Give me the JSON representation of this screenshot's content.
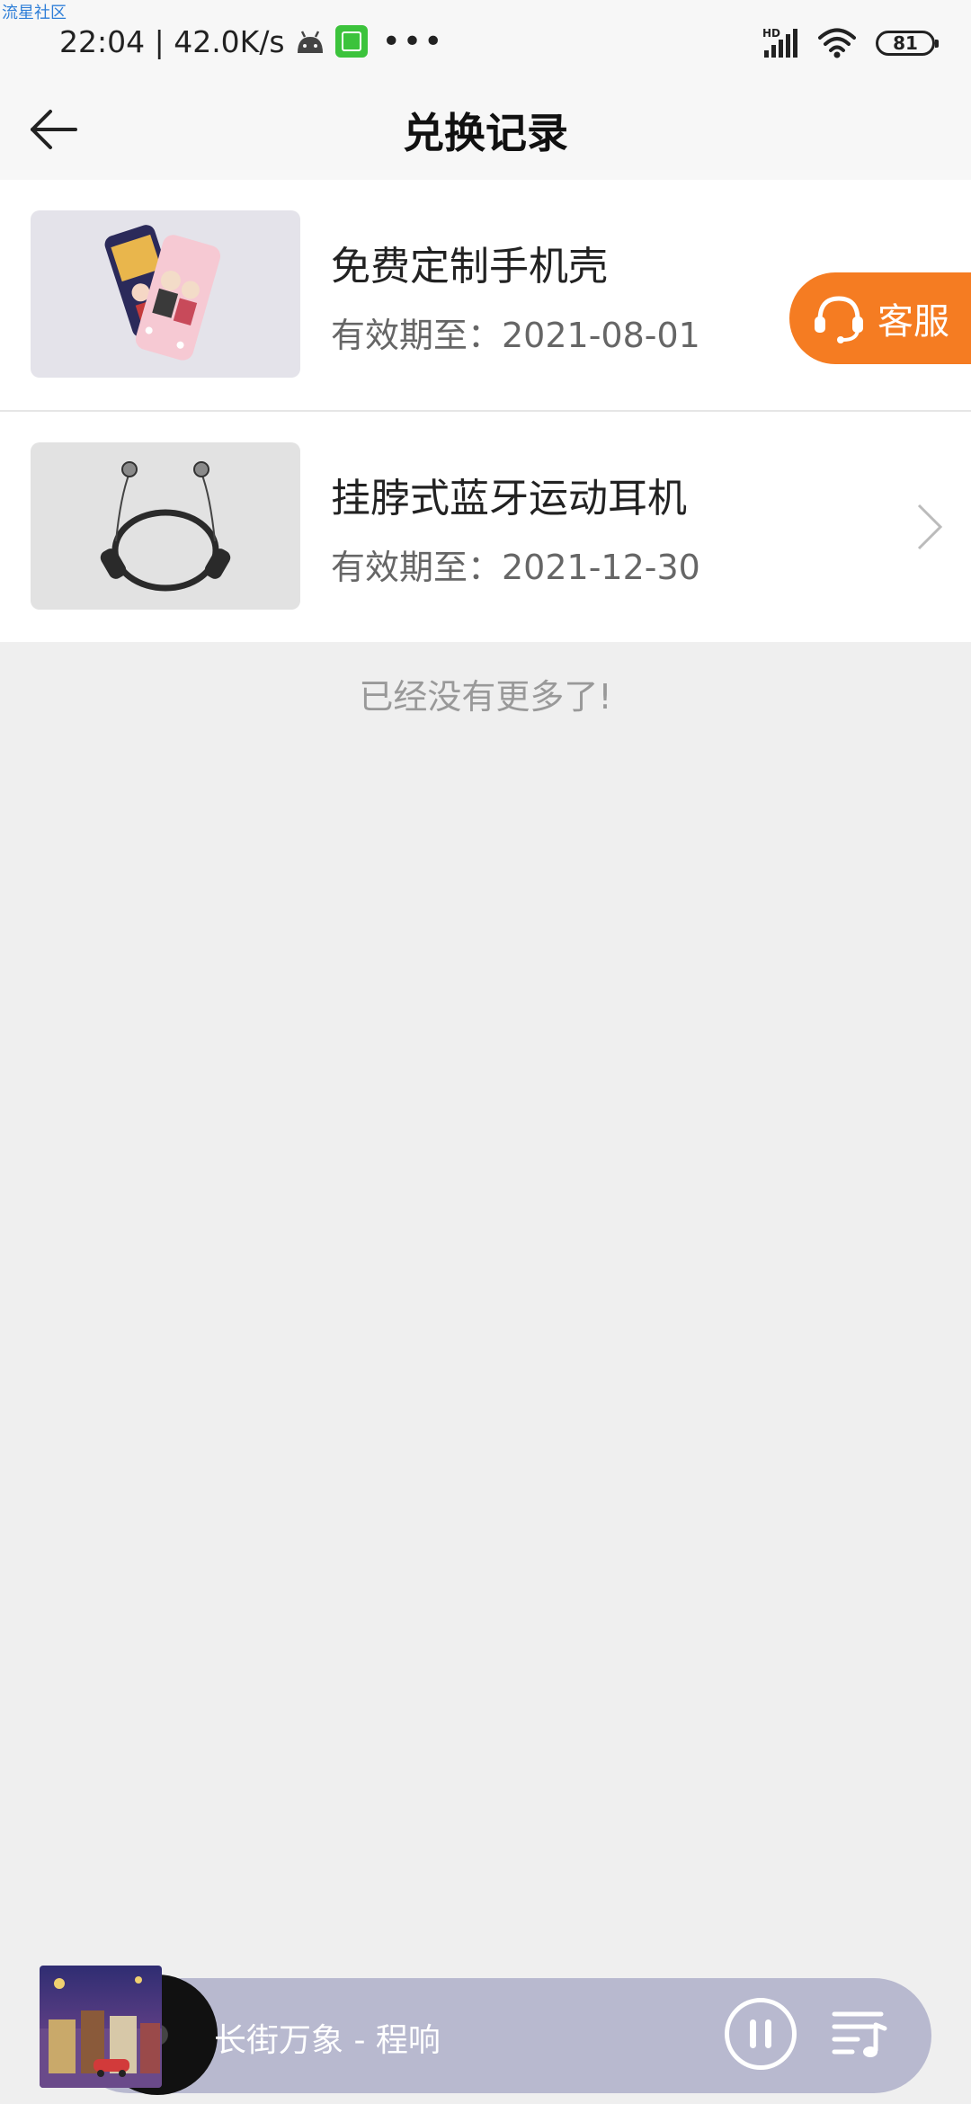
{
  "watermark": "流星社区",
  "status_bar": {
    "time_speed": "22:04 | 42.0K/s",
    "signal_label": "HD",
    "battery": "81"
  },
  "header": {
    "title": "兑换记录",
    "back_icon": "arrow-left-icon"
  },
  "records": [
    {
      "name": "免费定制手机壳",
      "expiry": "有效期至：2021-08-01",
      "image": "phone-case"
    },
    {
      "name": "挂脖式蓝牙运动耳机",
      "expiry": "有效期至：2021-12-30",
      "image": "neckband-earphones"
    }
  ],
  "customer_service": {
    "label": "客服",
    "icon": "headset-icon",
    "color": "#f57c22"
  },
  "end_text": "已经没有更多了!",
  "player": {
    "song": "长街万象 - 程响",
    "bar_color": "#b8b9cf"
  }
}
